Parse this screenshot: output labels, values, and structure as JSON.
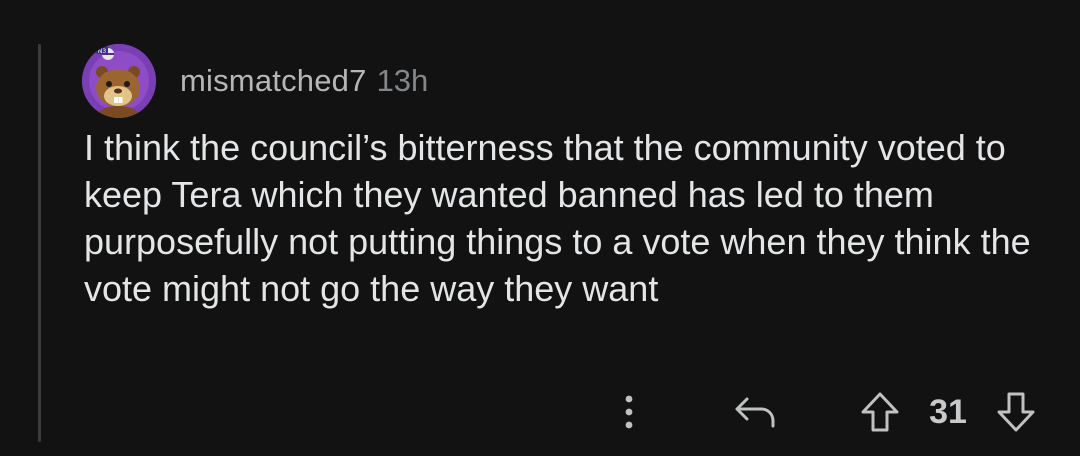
{
  "comment": {
    "username": "mismatched7",
    "timestamp": "13h",
    "body": "I think the council’s bitterness that the community voted to keep Tera which they wanted banned has led to them purposefully not putting things to a vote when they think the vote might not go the way they want",
    "avatar": {
      "icon": "bidoof-avatar-icon",
      "badge_text": "N3",
      "background": "#7b3fb5"
    }
  },
  "actions": {
    "more_icon": "more-vertical-icon",
    "reply_icon": "reply-arrow-icon",
    "upvote_icon": "upvote-arrow-icon",
    "downvote_icon": "downvote-arrow-icon",
    "score": "31"
  },
  "colors": {
    "background": "#121212",
    "thread_line": "#3a3a3a",
    "text": "#e3e5e7",
    "username": "#b4b6b8",
    "muted": "#84878a",
    "icon": "#bfc1c3"
  }
}
